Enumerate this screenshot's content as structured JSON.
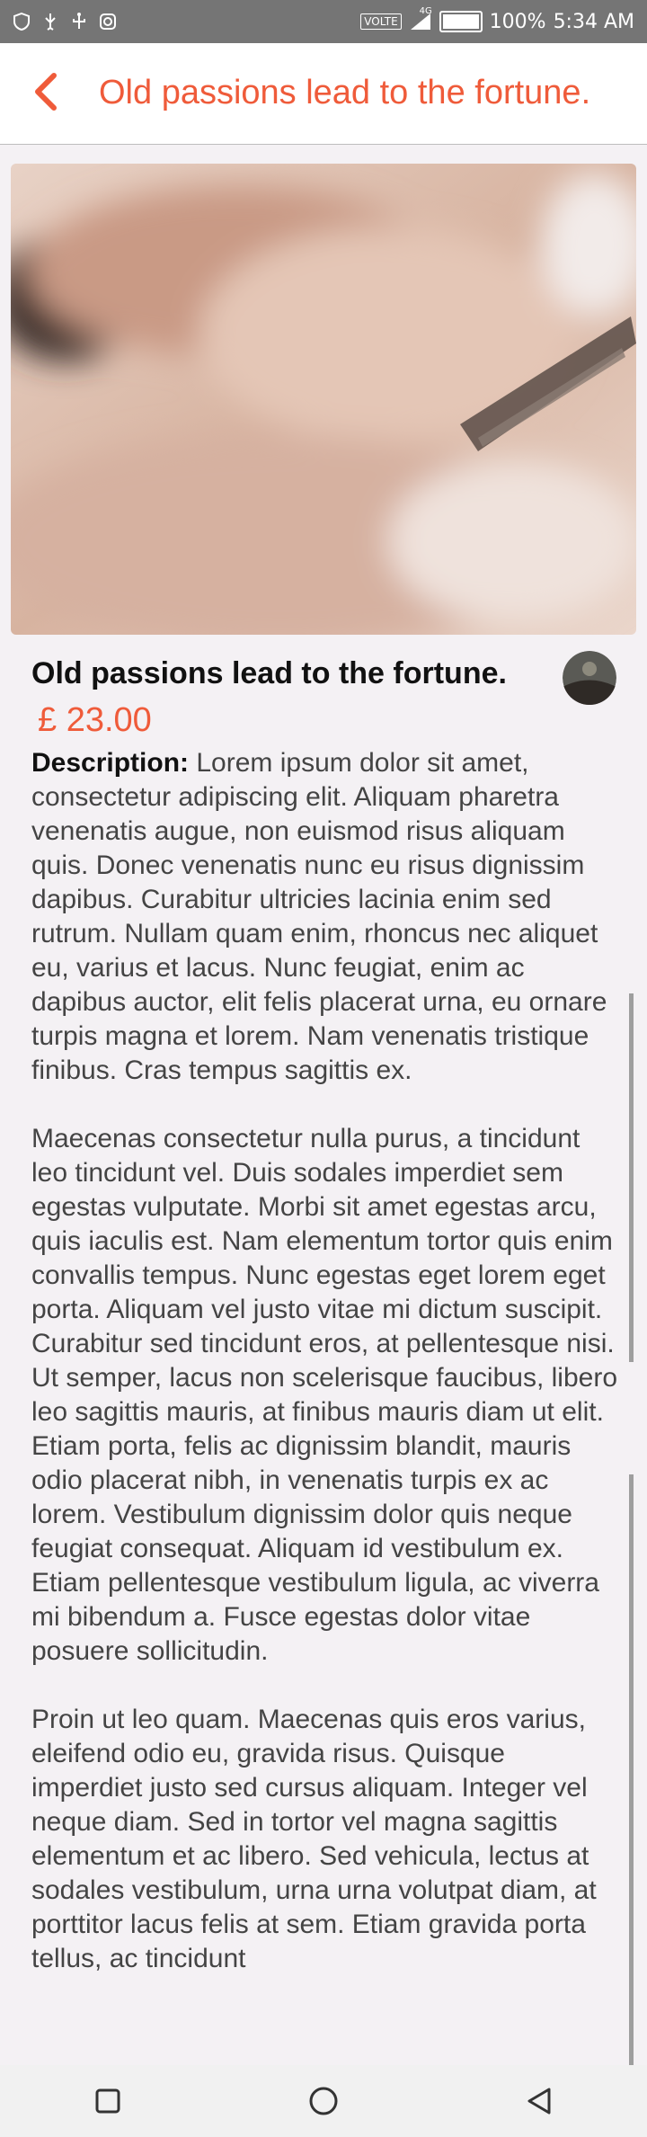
{
  "status_bar": {
    "network": "VOLTE",
    "network_badge": "4G",
    "battery": "100%",
    "time": "5:34 AM"
  },
  "app_bar": {
    "title": "Old passions lead to the fortune."
  },
  "product": {
    "title": "Old passions lead to the fortune.",
    "price": "£ 23.00",
    "description_label": "Description:",
    "paragraphs": [
      "Lorem ipsum dolor sit amet, consectetur adipiscing elit. Aliquam pharetra venenatis augue, non euismod risus aliquam quis. Donec venenatis nunc eu risus dignissim dapibus. Curabitur ultricies lacinia enim sed rutrum. Nullam quam enim, rhoncus nec aliquet eu, varius et lacus. Nunc feugiat, enim ac dapibus auctor, elit felis placerat urna, eu ornare turpis magna et lorem. Nam venenatis tristique finibus. Cras tempus sagittis ex.",
      "Maecenas consectetur nulla purus, a tincidunt leo tincidunt vel. Duis sodales imperdiet sem egestas vulputate. Morbi sit amet egestas arcu, quis iaculis est. Nam elementum tortor quis enim convallis tempus. Nunc egestas eget lorem eget porta. Aliquam vel justo vitae mi dictum suscipit. Curabitur sed tincidunt eros, at pellentesque nisi. Ut semper, lacus non scelerisque faucibus, libero leo sagittis mauris, at finibus mauris diam ut elit. Etiam porta, felis ac dignissim blandit, mauris odio placerat nibh, in venenatis turpis ex ac lorem. Vestibulum dignissim dolor quis neque feugiat consequat. Aliquam id vestibulum ex. Etiam pellentesque vestibulum ligula, ac viverra mi bibendum a. Fusce egestas dolor vitae posuere sollicitudin.",
      "Proin ut leo quam. Maecenas quis eros varius, eleifend odio eu, gravida risus. Quisque imperdiet justo sed cursus aliquam. Integer vel neque diam. Sed in tortor vel magna sagittis elementum et ac libero. Sed vehicula, lectus at sodales vestibulum, urna urna volutpat diam, at porttitor lacus felis at sem. Etiam gravida porta tellus, ac tincidunt"
    ]
  },
  "icons": {
    "back": "chevron-left-icon",
    "nav": [
      "recent-apps-icon",
      "home-icon",
      "back-triangle-icon"
    ]
  },
  "colors": {
    "accent": "#ef5b3a",
    "status_bar": "#757575",
    "background": "#f4f1f4"
  }
}
